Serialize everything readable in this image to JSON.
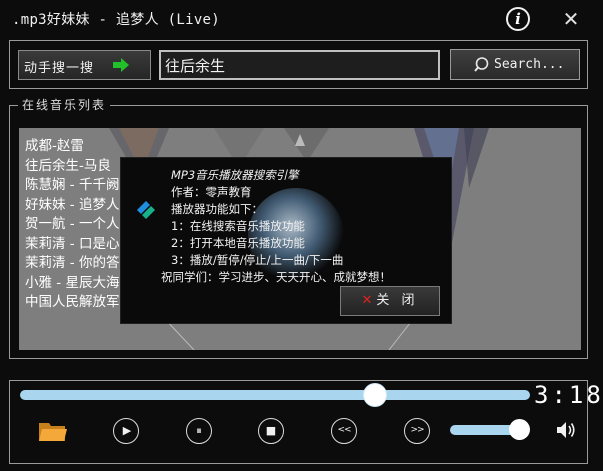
{
  "window": {
    "title": ".mp3好妹妹 - 追梦人 (Live)"
  },
  "search": {
    "label": "动手搜一搜",
    "query": "往后余生",
    "button_label": "Search..."
  },
  "song_list": {
    "legend": "在线音乐列表",
    "songs": [
      "成都-赵雷",
      "往后余生-马良",
      "陈慧娴 - 千千阙",
      "好妹妹 - 追梦人",
      "贺一航 - 一个人",
      "茉莉清 - 口是心",
      "茉莉清 - 你的答",
      "小雅 - 星辰大海",
      "中国人民解放军"
    ]
  },
  "about_dialog": {
    "lines": [
      "MP3音乐播放器搜索引擎",
      "作者：零声教育",
      "播放器功能如下：",
      "1：在线搜索音乐播放功能",
      "2：打开本地音乐播放功能",
      "3：播放/暂停/停止/上一曲/下一曲",
      "祝同学们：学习进步、天天开心、成就梦想！"
    ],
    "close_label": "关 闭"
  },
  "player": {
    "time": "3:18",
    "progress": 0.69,
    "volume": 0.82,
    "buttons": {
      "play": "▶",
      "pause": "⏸",
      "stop": "■",
      "prev": "<<",
      "next": ">>"
    }
  },
  "colors": {
    "accent": "#a9d6ee",
    "button_close_x": "#e02020",
    "arrow_green": "#22c02a",
    "folder": "#f0a030"
  }
}
